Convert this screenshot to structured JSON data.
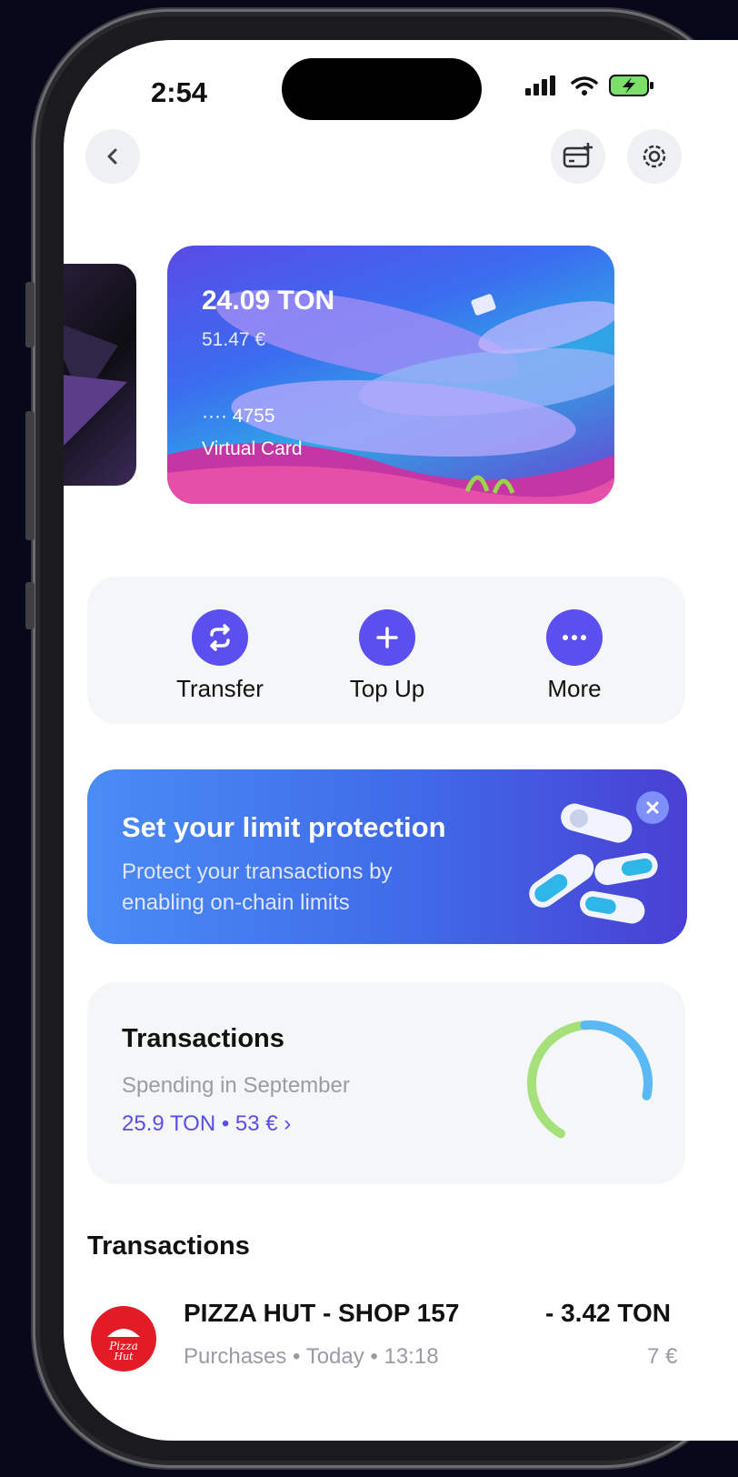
{
  "status_bar": {
    "time": "2:54"
  },
  "card": {
    "balance": "24.09 TON",
    "fiat": "51.47 €",
    "masked_number": "···· 4755",
    "label": "Virtual Card"
  },
  "actions": [
    {
      "label": "Transfer",
      "icon": "transfer-icon"
    },
    {
      "label": "Top Up",
      "icon": "plus-icon"
    },
    {
      "label": "More",
      "icon": "more-icon"
    }
  ],
  "banner": {
    "title": "Set your limit protection",
    "subtitle": "Protect your transactions by enabling on-chain limits"
  },
  "summary": {
    "title": "Transactions",
    "subtitle": "Spending in September",
    "amount": "25.9 TON • 53 € ›",
    "ring_colors": [
      "#5ab8f5",
      "#a6e07a"
    ]
  },
  "transactions_section": {
    "title": "Transactions"
  },
  "transactions": [
    {
      "merchant": "PIZZA HUT - SHOP 157",
      "meta": "Purchases • Today • 13:18",
      "amount": "- 3.42 TON",
      "fiat": "7 €",
      "logo_text": "Pizza Hut"
    }
  ],
  "colors": {
    "accent": "#5b4ff0",
    "banner": "#3f6ae8"
  }
}
